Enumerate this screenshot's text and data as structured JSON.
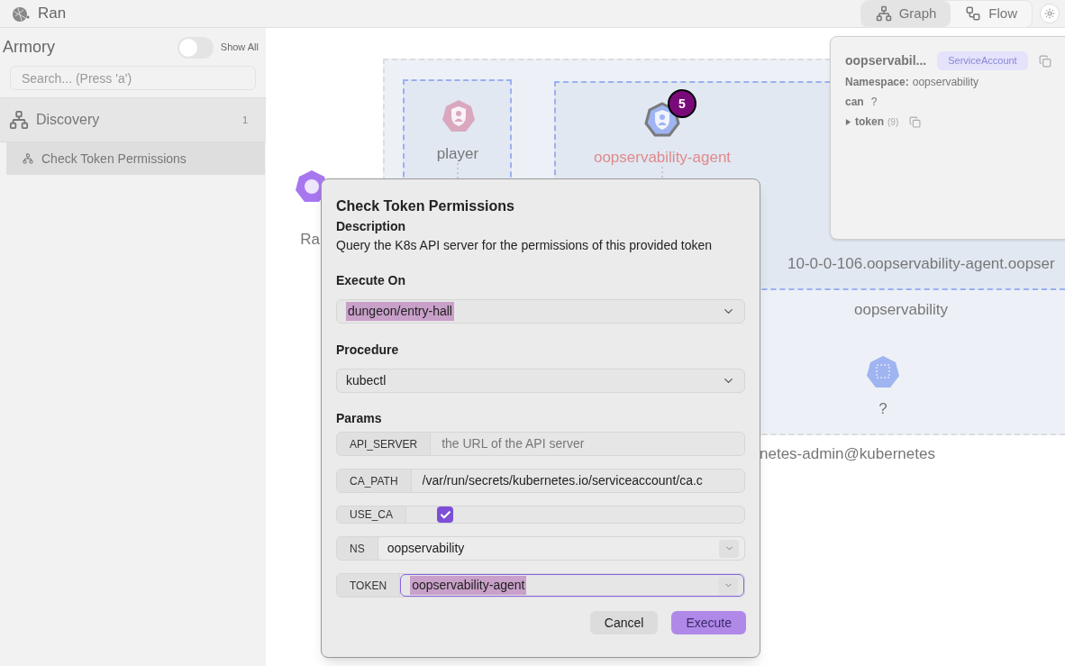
{
  "header": {
    "app_name": "Ran",
    "view_tabs": [
      {
        "label": "Graph",
        "selected": true
      },
      {
        "label": "Flow",
        "selected": false
      }
    ]
  },
  "sidebar": {
    "title": "Armory",
    "toggle": {
      "label": "Show All",
      "on": false
    },
    "search": {
      "placeholder": "Search... (Press 'a')"
    },
    "groups": [
      {
        "label": "Discovery",
        "count": "1",
        "expanded": true,
        "children": [
          {
            "label": "Check Token Permissions",
            "selected": true
          }
        ]
      }
    ]
  },
  "canvas": {
    "nodes": [
      {
        "kind": "role",
        "label": "player",
        "highlighted": false
      },
      {
        "kind": "serviceaccount",
        "label": "oopservability-agent",
        "badge": "5",
        "highlighted": true
      },
      {
        "kind": "namespace",
        "label": "?",
        "highlighted": false
      },
      {
        "kind": "cluster",
        "label": "Ra",
        "highlighted": false
      }
    ],
    "group_labels": [
      "10-0-0-106.oopservability-agent.oopser",
      "oopservability",
      "netes-admin@kubernetes"
    ]
  },
  "info_panel": {
    "title": "oopservabil...",
    "type": "ServiceAccount",
    "namespace_label": "Namespace:",
    "namespace": "oopservability",
    "can_label": "can",
    "can_value": "?",
    "token": {
      "label": "token",
      "count": "(9)",
      "expanded": false
    }
  },
  "dialog": {
    "title": "Check Token Permissions",
    "description_label": "Description",
    "description": "Query the K8s API server for the permissions of this provided token",
    "execute_on": {
      "label": "Execute On",
      "value": "dungeon/entry-hall",
      "highlighted": true
    },
    "procedure": {
      "label": "Procedure",
      "value": "kubectl",
      "highlighted": false
    },
    "params_label": "Params",
    "params": [
      {
        "name": "API_SERVER",
        "kind": "text",
        "placeholder": "the URL of the API server"
      },
      {
        "name": "CA_PATH",
        "kind": "text",
        "value": "/var/run/secrets/kubernetes.io/serviceaccount/ca.c"
      },
      {
        "name": "USE_CA",
        "kind": "checkbox",
        "checked": true
      },
      {
        "name": "NS",
        "kind": "select",
        "value": "oopservability",
        "focused": false,
        "highlighted": false
      },
      {
        "name": "TOKEN",
        "kind": "select",
        "value": "oopservability-agent",
        "focused": true,
        "highlighted": true
      }
    ],
    "buttons": {
      "cancel": "Cancel",
      "execute": "Execute"
    }
  }
}
